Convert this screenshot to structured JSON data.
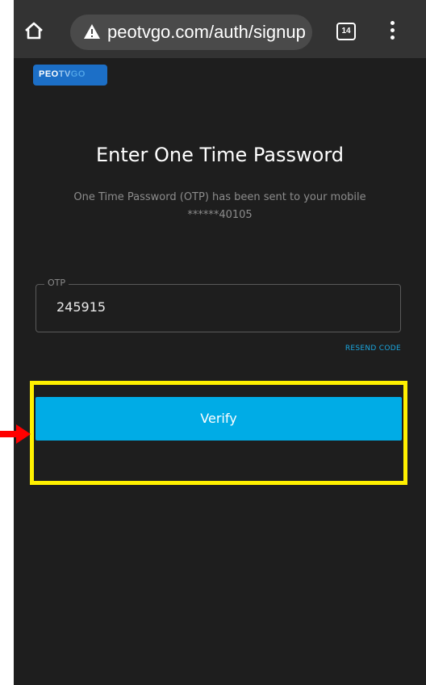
{
  "browser": {
    "url": "peotvgo.com/auth/signup",
    "tab_count": "14",
    "icons": {
      "home": "home-icon",
      "security": "warning-triangle-icon",
      "tabs": "tab-switcher-icon",
      "menu": "more-vert-icon"
    }
  },
  "logo": {
    "part1": "PEO",
    "part2": "TV",
    "part3": "GO"
  },
  "page": {
    "heading": "Enter One Time Password",
    "subtitle": "One Time Password (OTP) has been sent to your mobile ******40105"
  },
  "otp": {
    "label": "OTP",
    "value": "245915"
  },
  "actions": {
    "resend_label": "RESEND CODE",
    "verify_label": "Verify"
  },
  "colors": {
    "background": "#1e1e1e",
    "accent": "#00ace6",
    "highlight": "#fff000",
    "arrow": "#ff0000"
  }
}
